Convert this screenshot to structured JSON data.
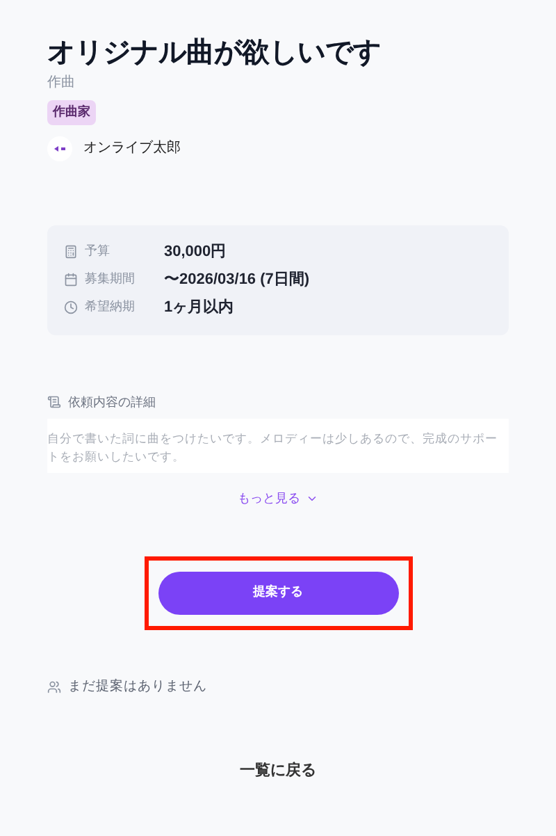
{
  "title": "オリジナル曲が欲しいです",
  "category": "作曲",
  "tag": "作曲家",
  "user": {
    "name": "オンライブ太郎"
  },
  "info": [
    {
      "kind": "budget",
      "label": "予算",
      "value": "30,000円"
    },
    {
      "kind": "period",
      "label": "募集期間",
      "value": "〜2026/03/16 (7日間)"
    },
    {
      "kind": "deadline",
      "label": "希望納期",
      "value": "1ヶ月以内"
    }
  ],
  "details": {
    "heading": "依頼内容の詳細",
    "body": "自分で書いた詞に曲をつけたいです。メロディーは少しあるので、完成のサポートをお願いしたいです。",
    "more": "もっと見る",
    "expanded": false
  },
  "propose_button": {
    "label": "提案する",
    "highlighted": true
  },
  "proposals": {
    "empty_text": "まだ提案はありません"
  },
  "back_link": "一覧に戻る"
}
